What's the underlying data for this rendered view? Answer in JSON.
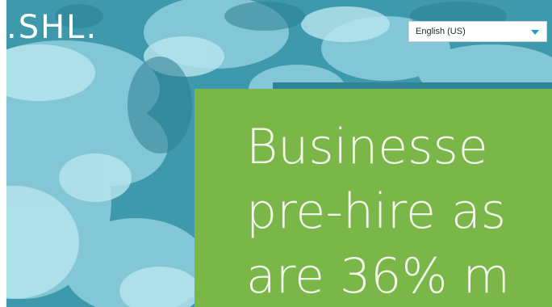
{
  "header": {
    "logo_text": ".SHL.",
    "language_select": {
      "selected": "English (US)"
    }
  },
  "hero": {
    "headline_lines": [
      "Businesse",
      "pre-hire as",
      "are 36% m"
    ]
  },
  "colors": {
    "sky_teal": "#4aa6b8",
    "cloud_light": "#a8dbe6",
    "panel_green": "#7ab648",
    "strip_teal": "#2f8596",
    "dropdown_caret": "#2196d3"
  },
  "icons": {
    "language_caret": "chevron-down-icon"
  }
}
